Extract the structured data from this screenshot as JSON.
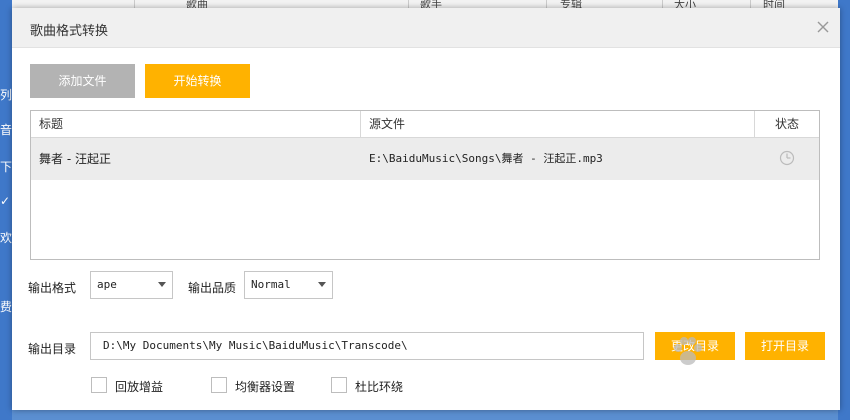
{
  "background": {
    "columns": [
      "歌曲",
      "歌手",
      "专辑",
      "大小",
      "时间"
    ],
    "sidebar_fragments": [
      "列",
      "音",
      "下",
      "✓",
      "欢",
      "费"
    ]
  },
  "dialog": {
    "title": "歌曲格式转换",
    "close_icon": "close-icon"
  },
  "toolbar": {
    "add_label": "添加文件",
    "start_label": "开始转换"
  },
  "table": {
    "headers": {
      "title": "标题",
      "source": "源文件",
      "status": "状态"
    },
    "rows": [
      {
        "title": "舞者 - 汪起正",
        "source": "E:\\BaiduMusic\\Songs\\舞者 - 汪起正.mp3",
        "status_icon": "clock-icon"
      }
    ]
  },
  "output": {
    "format_label": "输出格式",
    "format_value": "ape",
    "quality_label": "输出品质",
    "quality_value": "Normal",
    "dir_label": "输出目录",
    "dir_value": "D:\\My Documents\\My Music\\BaiduMusic\\Transcode\\",
    "change_dir_label": "更改目录",
    "open_dir_label": "打开目录"
  },
  "options": [
    {
      "label": "回放增益",
      "checked": false
    },
    {
      "label": "均衡器设置",
      "checked": false
    },
    {
      "label": "杜比环绕",
      "checked": false
    }
  ],
  "colors": {
    "accent": "#ffb200",
    "disabled": "#b3b3b3",
    "row_highlight": "#ececec"
  }
}
